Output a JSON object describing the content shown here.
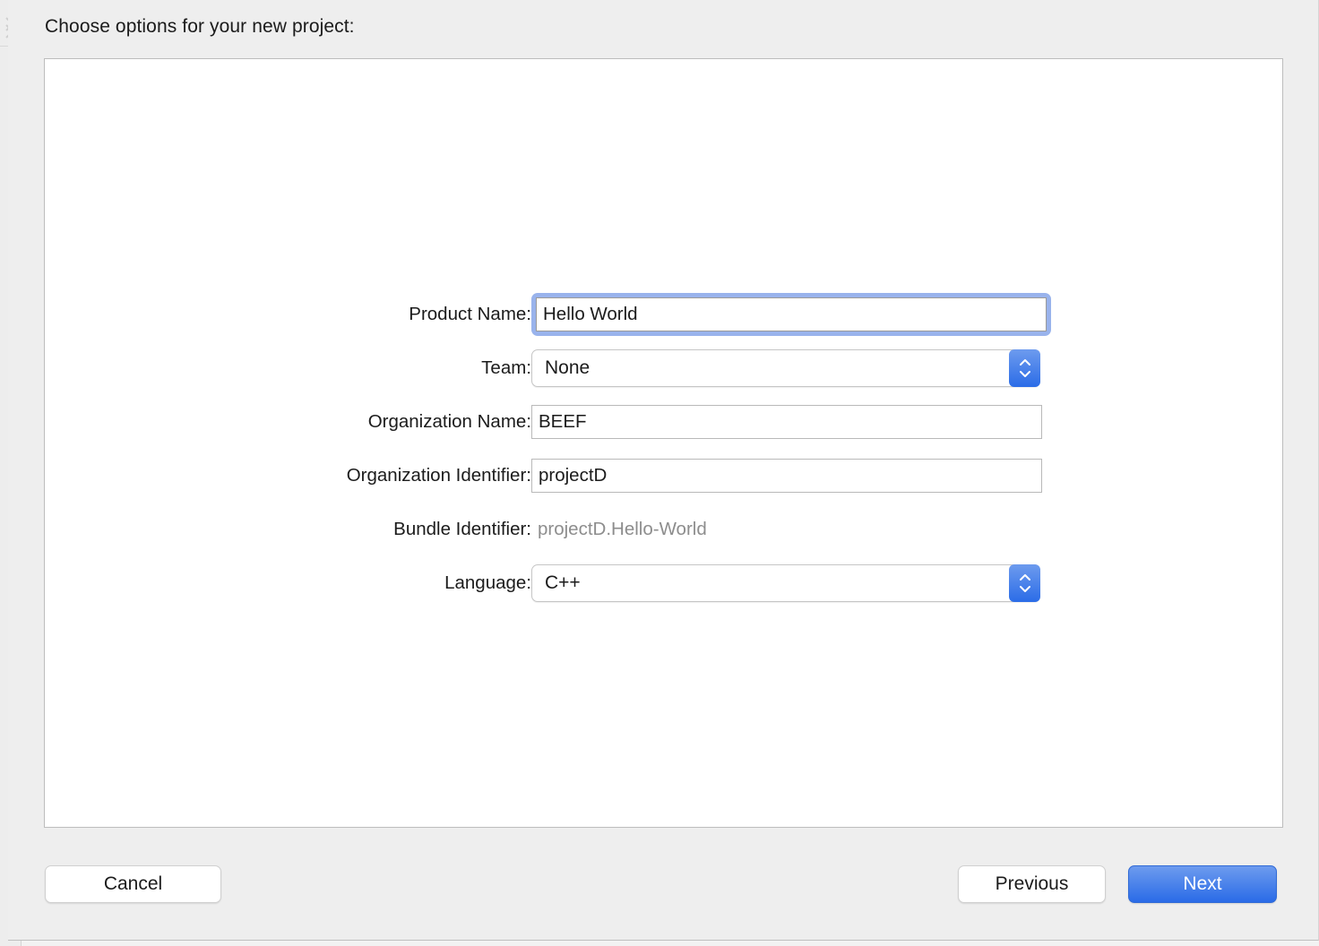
{
  "dialog": {
    "title": "Choose options for your new project:"
  },
  "form": {
    "rows": [
      {
        "label": "Product Name:",
        "type": "text",
        "value": "Hello World",
        "focused": true,
        "name": "product-name"
      },
      {
        "label": "Team:",
        "type": "popup",
        "value": "None",
        "name": "team"
      },
      {
        "label": "Organization Name:",
        "type": "text",
        "value": "BEEF",
        "focused": false,
        "name": "organization-name"
      },
      {
        "label": "Organization Identifier:",
        "type": "text",
        "value": "projectD",
        "focused": false,
        "name": "organization-identifier"
      },
      {
        "label": "Bundle Identifier:",
        "type": "static",
        "value": "projectD.Hello-World",
        "name": "bundle-identifier"
      },
      {
        "label": "Language:",
        "type": "popup",
        "value": "C++",
        "name": "language"
      }
    ]
  },
  "footer": {
    "cancel_label": "Cancel",
    "previous_label": "Previous",
    "next_label": "Next"
  },
  "colors": {
    "accent_blue": "#2a6be7",
    "accent_blue_light": "#6d9bee",
    "focus_ring": "#99b3ec",
    "sheet_background": "#eeeeee",
    "well_background": "#ffffff",
    "static_text": "#8d8d8d",
    "label_text": "#1b1b1b"
  }
}
